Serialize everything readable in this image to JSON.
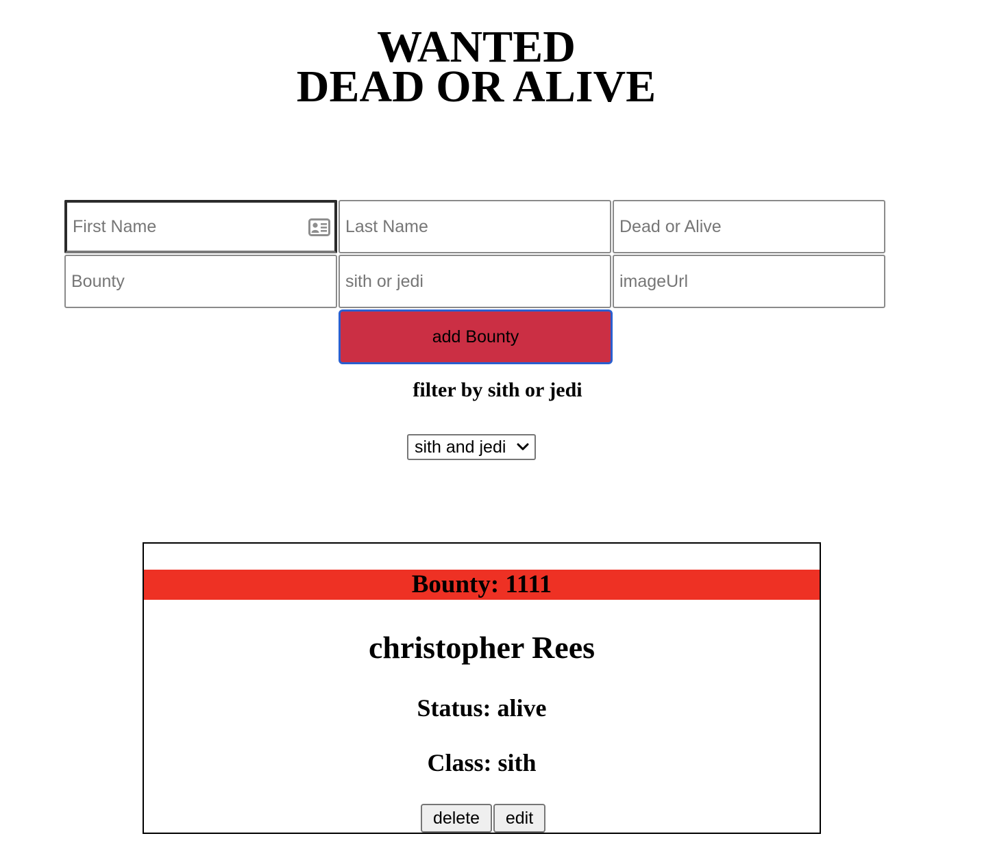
{
  "header": {
    "title_line1": "WANTED",
    "title_line2": "DEAD OR ALIVE"
  },
  "form": {
    "first_name_placeholder": "First Name",
    "last_name_placeholder": "Last Name",
    "dead_or_alive_placeholder": "Dead or Alive",
    "bounty_placeholder": "Bounty",
    "class_placeholder": "sith or jedi",
    "image_url_placeholder": "imageUrl",
    "first_name_value": "",
    "last_name_value": "",
    "dead_or_alive_value": "",
    "bounty_value": "",
    "class_value": "",
    "image_url_value": "",
    "submit_label": "add Bounty",
    "autofill_icon": "contact-card-icon"
  },
  "filter": {
    "label": "filter by sith or jedi",
    "selected": "sith and jedi"
  },
  "bounties": [
    {
      "bounty_text": "Bounty: 1111",
      "name": "christopher Rees",
      "status_text": "Status: alive",
      "class_text": "Class: sith",
      "delete_label": "delete",
      "edit_label": "edit"
    }
  ],
  "colors": {
    "submit_bg": "#cb2f44",
    "submit_border": "#2a5fcf",
    "bounty_bar": "#ee3124"
  }
}
